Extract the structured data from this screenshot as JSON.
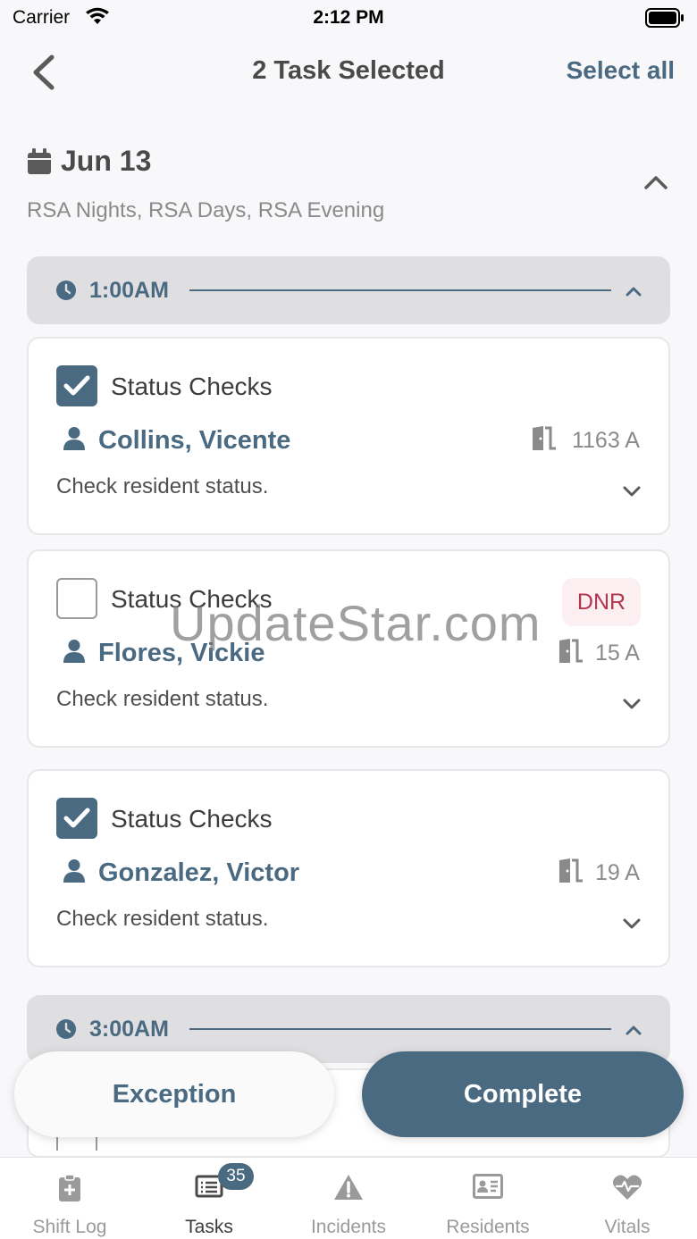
{
  "status_bar": {
    "carrier": "Carrier",
    "time": "2:12 PM"
  },
  "nav": {
    "title": "2  Task Selected",
    "select_all": "Select all"
  },
  "date_header": {
    "date": "Jun 13",
    "shifts": "RSA Nights, RSA Days, RSA Evening"
  },
  "groups": [
    {
      "time": "1:00AM"
    },
    {
      "time": "3:00AM"
    }
  ],
  "tasks": [
    {
      "title": "Status Checks",
      "resident": "Collins, Vicente",
      "room": "1163 A",
      "description": "Check resident status.",
      "checked": true,
      "badge": ""
    },
    {
      "title": "Status Checks",
      "resident": "Flores, Vickie",
      "room": "15 A",
      "description": "Check resident status.",
      "checked": false,
      "badge": "DNR"
    },
    {
      "title": "Status Checks",
      "resident": "Gonzalez, Victor",
      "room": "19 A",
      "description": "Check resident status.",
      "checked": true,
      "badge": ""
    }
  ],
  "watermark": "UpdateStar.com",
  "actions": {
    "exception": "Exception",
    "complete": "Complete"
  },
  "tabs": [
    {
      "label": "Shift Log",
      "icon": "clipboard-plus-icon"
    },
    {
      "label": "Tasks",
      "icon": "task-list-icon",
      "badge": "35",
      "active": true
    },
    {
      "label": "Incidents",
      "icon": "warning-icon"
    },
    {
      "label": "Residents",
      "icon": "id-card-icon"
    },
    {
      "label": "Vitals",
      "icon": "heartbeat-icon"
    }
  ],
  "colors": {
    "accent": "#4a6a82",
    "dnr": "#b3364f",
    "background": "#f8f7f9"
  }
}
